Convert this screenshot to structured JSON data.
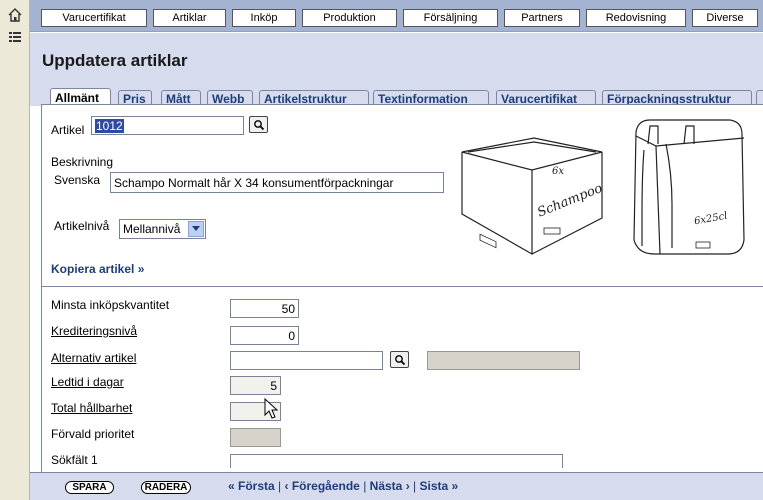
{
  "toolbar": {
    "icons": [
      "home-icon",
      "list-icon"
    ]
  },
  "topnav": {
    "items": [
      {
        "label": "Varucertifikat"
      },
      {
        "label": "Artiklar"
      },
      {
        "label": "Inköp"
      },
      {
        "label": "Produktion"
      },
      {
        "label": "Försäljning"
      },
      {
        "label": "Partners"
      },
      {
        "label": "Redovisning"
      },
      {
        "label": "Diverse"
      }
    ]
  },
  "page": {
    "title": "Uppdatera artiklar"
  },
  "tabs": [
    {
      "label": "Allmänt",
      "active": true
    },
    {
      "label": "Pris"
    },
    {
      "label": "Mått"
    },
    {
      "label": "Webb"
    },
    {
      "label": "Artikelstruktur"
    },
    {
      "label": "Textinformation"
    },
    {
      "label": "Varucertifikat"
    },
    {
      "label": "Förpackningsstruktur"
    }
  ],
  "form": {
    "artikel_label": "Artikel",
    "artikel_value": "1012",
    "beskrivning_label": "Beskrivning",
    "svenska_label": "Svenska",
    "svenska_value": "Schampo Normalt hår X 34 konsumentförpackningar",
    "artikelniva_label": "Artikelnivå",
    "artikelniva_value": "Mellannivå",
    "copy_link": "Kopiera artikel »",
    "illustration_text": {
      "box_label": "6x",
      "box_brand": "Schampoo",
      "crate_label": "6x25cl"
    }
  },
  "fields": [
    {
      "label": "Minsta inköpskvantitet",
      "value": "50"
    },
    {
      "label": "Krediteringsnivå",
      "value": "0"
    },
    {
      "label": "Alternativ artikel",
      "value": ""
    },
    {
      "label": "Ledtid i dagar",
      "value": "5"
    },
    {
      "label": "Total hållbarhet",
      "value": ""
    },
    {
      "label": "Förvald prioritet",
      "value": ""
    },
    {
      "label": "Sökfält 1",
      "value": ""
    }
  ],
  "bottom": {
    "save_label": "SPARA",
    "delete_label": "RADERA",
    "pager": {
      "first": "« Första",
      "prev": "‹ Föregående",
      "next": "Nästa ›",
      "last": "Sista »",
      "separator": "|"
    }
  }
}
